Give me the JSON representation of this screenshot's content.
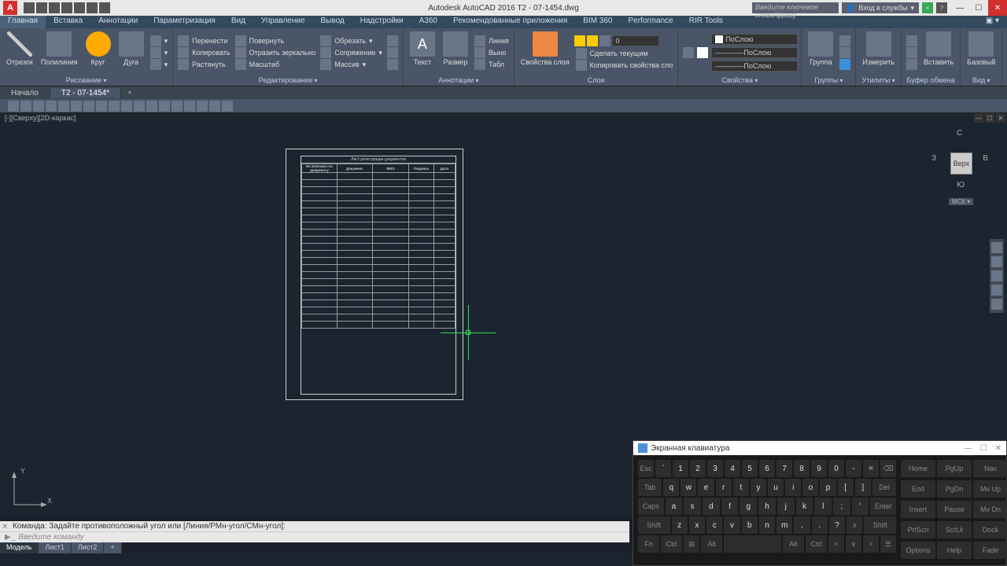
{
  "titlebar": {
    "app": "A",
    "title": "Autodesk AutoCAD 2016   T2 - 07-1454.dwg",
    "search_placeholder": "Введите ключевое слово/фразу",
    "login": "Вход в службы",
    "help": "?"
  },
  "ribbon_tabs": [
    "Главная",
    "Вставка",
    "Аннотации",
    "Параметризация",
    "Вид",
    "Управление",
    "Вывод",
    "Надстройки",
    "A360",
    "Рекомендованные приложения",
    "BIM 360",
    "Performance",
    "RIR Tools"
  ],
  "ribbon": {
    "draw": {
      "items": [
        "Отрезок",
        "Полилиния",
        "Круг",
        "Дуга"
      ],
      "label": "Рисование"
    },
    "modify": {
      "rows": [
        [
          "Перенести",
          "Повернуть",
          "Обрезать"
        ],
        [
          "Копировать",
          "Отразить зеркально",
          "Сопряжение"
        ],
        [
          "Растянуть",
          "Масштаб",
          "Массив"
        ]
      ],
      "label": "Редактирование"
    },
    "annot": {
      "items": [
        "Текст",
        "Размер",
        "Линия",
        "Выно",
        "Табл"
      ],
      "label": "Аннотации"
    },
    "layers": {
      "btn": "Свойства слоя",
      "actions": [
        "Сделать текущим",
        "Копировать свойства сло"
      ],
      "label": "Слои"
    },
    "props": {
      "items": [
        "ПоСлою",
        "ПоСлою",
        "ПоСлою"
      ],
      "label": "Свойства"
    },
    "groups": {
      "item": "Группа",
      "label": "Группы"
    },
    "utils": {
      "item": "Измерить",
      "label": "Утилиты"
    },
    "clip": {
      "item": "Вставить",
      "label": "Буфер обмена"
    },
    "base": {
      "item": "Базовый",
      "label": "Вид"
    }
  },
  "doc_tabs": {
    "tabs": [
      "Начало",
      "T2 - 07-1454*"
    ],
    "active": 1
  },
  "viewport_label": "[-][Сверху][2D-каркас]",
  "table": {
    "title": "Лист регистрации документов",
    "headers": [
      "Но вписаны по документу",
      "Документ",
      "ФИО",
      "Подпись",
      "Дата"
    ]
  },
  "viewcube": {
    "face": "Верх",
    "n": "С",
    "s": "Ю",
    "w": "З",
    "e": "В",
    "wcs": "МСК"
  },
  "ucs": {
    "x": "X",
    "y": "Y"
  },
  "cmdline": {
    "history": "Команда: Задайте противоположный угол или [Линия/РМн-угол/СМн-угол]:",
    "prompt": "Введите команду"
  },
  "bottom_tabs": [
    "Модель",
    "Лист1",
    "Лист2"
  ],
  "osk": {
    "title": "Экранная клавиатура",
    "rows": [
      [
        "Esc",
        "`",
        "1",
        "2",
        "3",
        "4",
        "5",
        "6",
        "7",
        "8",
        "9",
        "0",
        "-",
        "=",
        "⌫"
      ],
      [
        "Tab",
        "q",
        "w",
        "e",
        "r",
        "t",
        "y",
        "u",
        "i",
        "o",
        "p",
        "[",
        "]",
        "Del"
      ],
      [
        "Caps",
        "a",
        "s",
        "d",
        "f",
        "g",
        "h",
        "j",
        "k",
        "l",
        ";",
        "'",
        "Enter"
      ],
      [
        "Shift",
        "z",
        "x",
        "c",
        "v",
        "b",
        "n",
        "m",
        ",",
        ".",
        "?",
        "∧",
        "Shift"
      ],
      [
        "Fn",
        "Ctrl",
        "⊞",
        "Alt",
        " ",
        "Alt",
        "Ctrl",
        "<",
        "∨",
        ">",
        "☰"
      ]
    ],
    "side": [
      [
        "Home",
        "PgUp",
        "Nav"
      ],
      [
        "End",
        "PgDn",
        "Mv Up"
      ],
      [
        "Insert",
        "Pause",
        "Mv Dn"
      ],
      [
        "PrtScn",
        "ScrLk",
        "Dock"
      ],
      [
        "Options",
        "Help",
        "Fade"
      ]
    ]
  }
}
